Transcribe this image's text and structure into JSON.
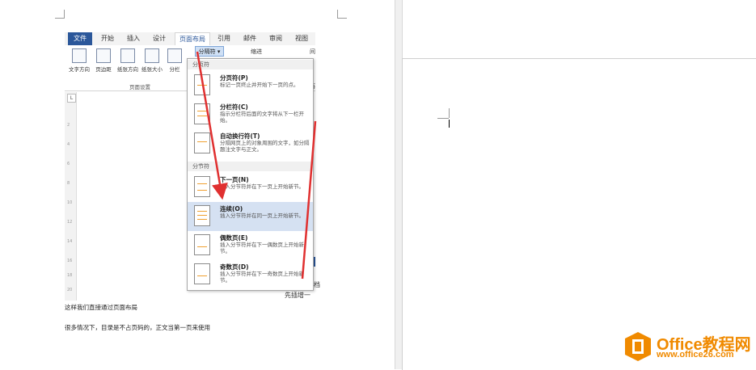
{
  "ribbon": {
    "tabs": [
      "文件",
      "开始",
      "插入",
      "设计",
      "页面布局",
      "引用",
      "邮件",
      "审阅",
      "视图"
    ],
    "buttons": [
      "文字方向",
      "页边距",
      "纸张方向",
      "纸张大小",
      "分栏"
    ],
    "group_label": "页面设置",
    "split_button_label": "分隔符 ▾",
    "indent_label": "缩进",
    "spacing_label": "间",
    "paragraph_label": "段落"
  },
  "dropdown": {
    "section_page": "分页符",
    "section_section": "分节符",
    "items": [
      {
        "title": "分页符(P)",
        "desc": "标记一页终止并开始下一页的点。"
      },
      {
        "title": "分栏符(C)",
        "desc": "指示分栏符后面的文字将从下一栏开始。"
      },
      {
        "title": "自动换行符(T)",
        "desc": "分隔网页上的对象周围的文字，如分隔题注文字与正文。"
      },
      {
        "title": "下一页(N)",
        "desc": "插入分节符并在下一页上开始新节。"
      },
      {
        "title": "连续(O)",
        "desc": "插入分节符并在同一页上开始新节。"
      },
      {
        "title": "偶数页(E)",
        "desc": "插入分节符并在下一偶数页上开始新节。"
      },
      {
        "title": "奇数页(D)",
        "desc": "插入分节符并在下一奇数页上开始新节。"
      }
    ]
  },
  "ruler": {
    "corner": "L",
    "numbers": [
      "2",
      "4",
      "6",
      "8",
      "10",
      "12",
      "14",
      "16",
      "18",
      "20"
    ]
  },
  "partial_texts": {
    "side1": "篇文档",
    "side2": "先插增一"
  },
  "body": {
    "line1": "这样我们直接通过页面布局",
    "line2": "很多情况下，目录是不占页码的，正文当第一页来使用"
  },
  "watermark": {
    "brand": "Office教程网",
    "url": "www.office26.com"
  },
  "colors": {
    "accent": "#2b579a",
    "highlight": "#d5e1f2",
    "arrow": "#e03030",
    "watermark": "#f08a00"
  }
}
